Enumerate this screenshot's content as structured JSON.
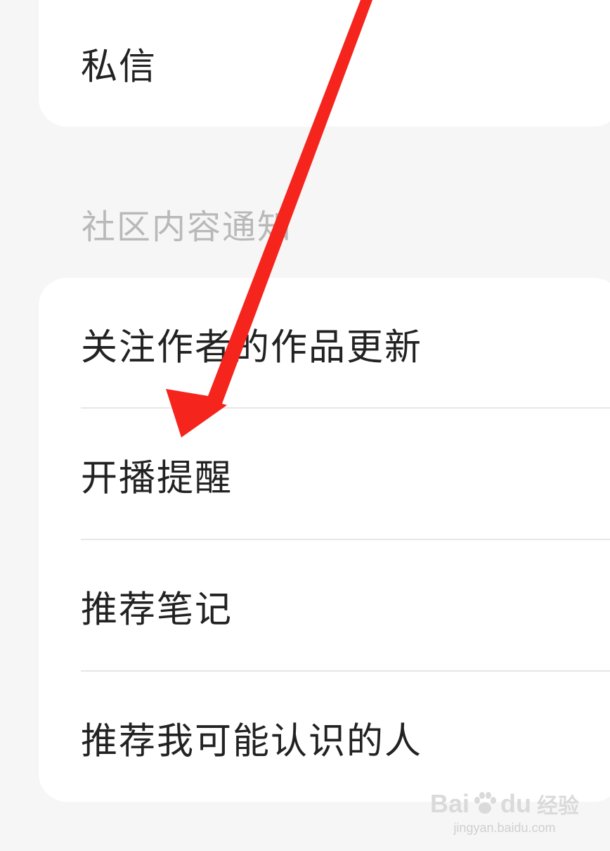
{
  "messages_item": {
    "label": "私信"
  },
  "community_section": {
    "header": "社区内容通知",
    "items": [
      {
        "label": "关注作者的作品更新"
      },
      {
        "label": "开播提醒"
      },
      {
        "label": "推荐笔记"
      },
      {
        "label": "推荐我可能认识的人"
      }
    ]
  },
  "annotation": {
    "arrow_color": "#f5241c"
  },
  "watermark": {
    "logo_left": "Bai",
    "logo_right": "du",
    "logo_suffix": "经验",
    "url": "jingyan.baidu.com"
  }
}
